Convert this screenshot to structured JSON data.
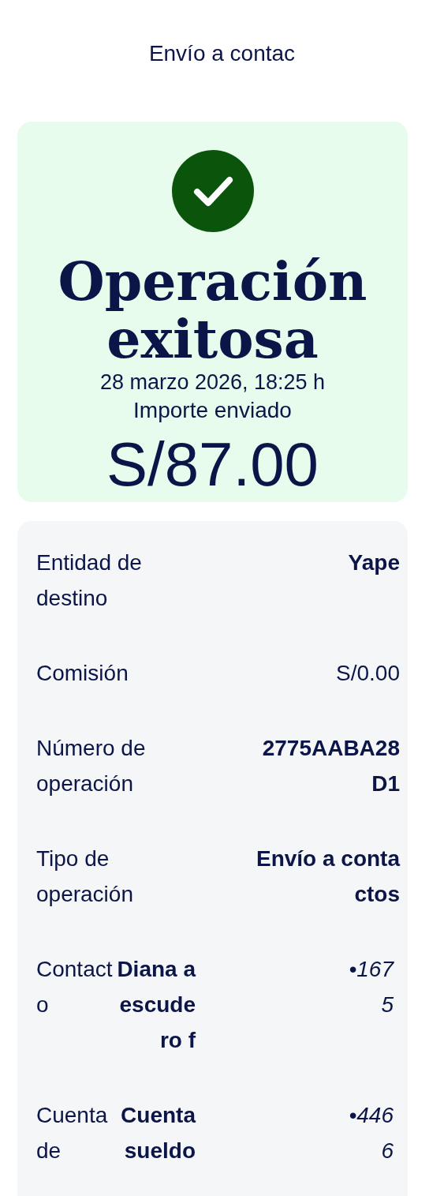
{
  "header": {
    "title": "Envío a contac"
  },
  "result": {
    "title": "Operación exitosa",
    "date": "28 marzo 2026, 18:25 h",
    "amount_label": "Importe enviado",
    "amount": "S/87.00"
  },
  "details": [
    {
      "label": "Entidad de destino",
      "value": "Yape",
      "bold": true
    },
    {
      "label": "Comisión",
      "value": "S/0.00",
      "bold": false
    },
    {
      "label": "Número de operación",
      "value": "2775AABA28D1",
      "bold": true
    },
    {
      "label": "Tipo de operación",
      "value": "Envío a contactos",
      "bold": true
    },
    {
      "label": "Contacto",
      "value": "Diana a escudero f",
      "bold": true,
      "extra": "•1675"
    },
    {
      "label": "Cuenta de",
      "value": "Cuenta sueldo",
      "bold": true,
      "extra": "•4466"
    }
  ]
}
